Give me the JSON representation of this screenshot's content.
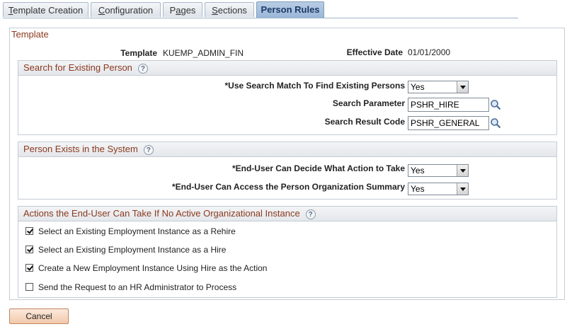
{
  "tabs": [
    {
      "label": "Template Creation",
      "ul": "T",
      "rest": "emplate Creation"
    },
    {
      "label": "Configuration",
      "ul": "C",
      "rest": "onfiguration"
    },
    {
      "label": "Pages",
      "pre": "P",
      "ul": "a",
      "rest": "ges"
    },
    {
      "label": "Sections",
      "ul": "S",
      "rest": "ections"
    },
    {
      "label": "Person Rules",
      "active": true
    }
  ],
  "template": {
    "group_title": "Template",
    "template_label": "Template",
    "template_value": "KUEMP_ADMIN_FIN",
    "eff_date_label": "Effective Date",
    "eff_date_value": "01/01/2000"
  },
  "search_section": {
    "title": "Search for Existing Person",
    "use_search_label": "*Use Search Match To Find Existing Persons",
    "use_search_value": "Yes",
    "search_param_label": "Search Parameter",
    "search_param_value": "PSHR_HIRE",
    "search_result_label": "Search Result Code",
    "search_result_value": "PSHR_GENERAL"
  },
  "exists_section": {
    "title": "Person Exists in the System",
    "decide_label": "*End-User Can Decide What Action to Take",
    "decide_value": "Yes",
    "access_label": "*End-User Can Access the Person Organization Summary",
    "access_value": "Yes"
  },
  "actions_section": {
    "title": "Actions the End-User Can Take If No Active Organizational Instance",
    "items": [
      {
        "label": "Select an Existing Employment Instance as a Rehire",
        "checked": true
      },
      {
        "label": "Select an Existing Employment Instance as a Hire",
        "checked": true
      },
      {
        "label": "Create a New Employment Instance Using Hire as the Action",
        "checked": true
      },
      {
        "label": "Send the Request to an HR Administrator to Process",
        "checked": false
      }
    ]
  },
  "cancel_label": "Cancel",
  "help_glyph": "?",
  "colors": {
    "section_title": "#8b3a1e",
    "active_tab": "#9ab7d8",
    "button": "#f2c9ab"
  }
}
